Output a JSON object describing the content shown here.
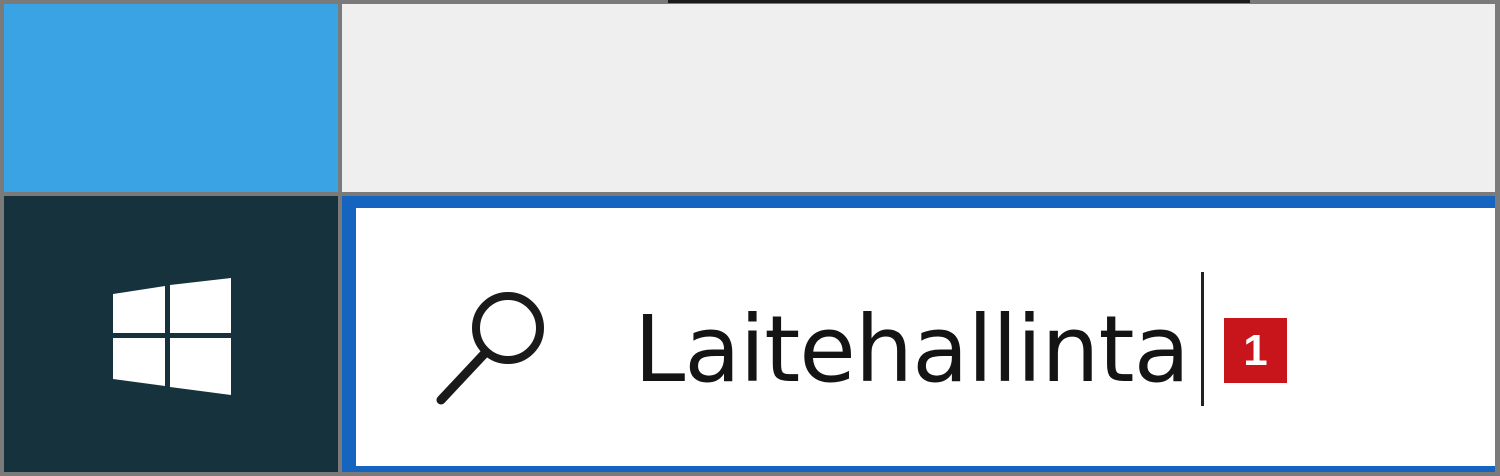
{
  "taskbar": {
    "start_icon": "windows-logo-icon",
    "search": {
      "icon": "search-icon",
      "value": "Laitehallinta"
    }
  },
  "annotation": {
    "step_number": "1"
  },
  "colors": {
    "tile_blue": "#3aa3e3",
    "top_panel_gray": "#efefef",
    "taskbar_dark": "#16323d",
    "search_border_blue": "#1565c0",
    "badge_red": "#c8141b"
  }
}
